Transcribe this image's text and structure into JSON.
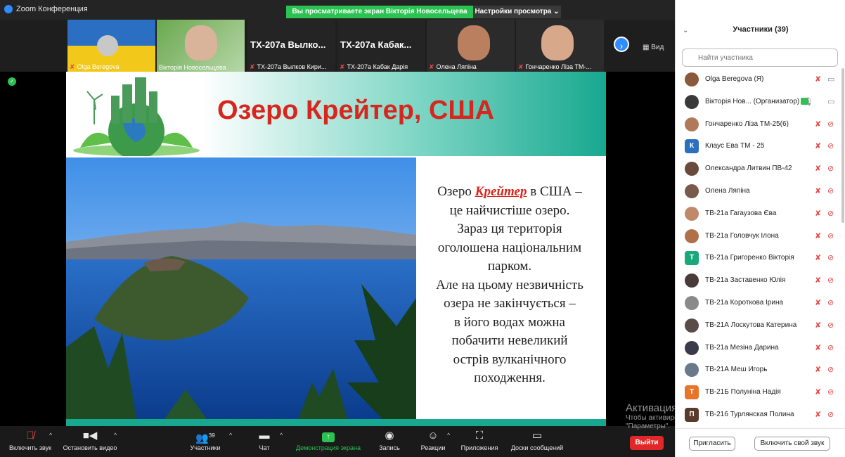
{
  "window": {
    "title": "Zoom Конференция"
  },
  "banner": {
    "viewing_text": "Вы просматриваете экран Вікторія Новосельцева",
    "view_settings": "Настройки просмотра ⌄"
  },
  "window_controls": {
    "minimize": "–",
    "maximize": "◻",
    "close": "✕"
  },
  "thumbnails": [
    {
      "name": "Olga Beregova",
      "muted": true,
      "type": "flag"
    },
    {
      "name": "Вікторія Новосельцева",
      "muted": false,
      "type": "video"
    },
    {
      "name": "ТХ-207а Вылков Кири...",
      "big_label": "ТХ-207а Вылко...",
      "muted": true,
      "type": "text"
    },
    {
      "name": "ТХ-207а Кабак Дарія",
      "big_label": "ТХ-207а Кабак...",
      "muted": true,
      "type": "text"
    },
    {
      "name": "Олена Ляпіна",
      "muted": true,
      "type": "video"
    },
    {
      "name": "Гончаренко Ліза ТМ-...",
      "muted": true,
      "type": "video"
    }
  ],
  "view_button": "Вид",
  "slide": {
    "title": "Озеро Крейтер, США",
    "text_before_link": "Озеро ",
    "link_word": "Крейтер",
    "text_after_link": " в США –",
    "body_lines": [
      "це найчистіше озеро.",
      "Зараз ця територія",
      "оголошена національним",
      "парком.",
      "Але на цьому незвичність",
      "озера не закінчується –",
      "в його водах можна",
      "побачити невеликий",
      "острів вулканічного",
      "походження."
    ]
  },
  "toolbar": {
    "unmute": "Включить звук",
    "stop_video": "Остановить видео",
    "participants": "Участники",
    "participants_count": "39",
    "chat": "Чат",
    "share_screen": "Демонстрация экрана",
    "record": "Запись",
    "reactions": "Реакции",
    "apps": "Приложения",
    "whiteboards": "Доски сообщений",
    "leave": "Выйти"
  },
  "watermark": {
    "line1": "Активация Windows",
    "line2": "Чтобы активировать Windows, перейдите в раздел",
    "line3": "\"Параметры\"."
  },
  "panel": {
    "title": "Участники (39)",
    "search_placeholder": "Найти участника",
    "invite_button": "Пригласить",
    "unmute_me_button": "Включить свой звук",
    "participants": [
      {
        "name": "Olga Beregova (Я)",
        "avatar": "photo",
        "color": "#8a5a3a"
      },
      {
        "name": "Вікторія Нов... (Организатор)",
        "avatar": "photo",
        "color": "#3a3a3a",
        "host": true
      },
      {
        "name": "Гончаренко Ліза ТМ-25(6)",
        "avatar": "photo",
        "color": "#b07a5a"
      },
      {
        "name": "Клаус Ева ТМ - 25",
        "avatar": "К",
        "color": "#2d6fbf"
      },
      {
        "name": "Олександра Литвин ПВ-42",
        "avatar": "photo",
        "color": "#6a4a3a"
      },
      {
        "name": "Олена Ляпіна",
        "avatar": "photo",
        "color": "#7a5a4a"
      },
      {
        "name": "ТВ-21а Гагаузова Єва",
        "avatar": "photo",
        "color": "#c08a6a"
      },
      {
        "name": "ТВ-21а Головчук Ілона",
        "avatar": "photo",
        "color": "#b0704a"
      },
      {
        "name": "ТВ-21а Григоренко Вікторія",
        "avatar": "Т",
        "color": "#1aa87a"
      },
      {
        "name": "ТВ-21а Заставенко Юлія",
        "avatar": "photo",
        "color": "#4a3a3a"
      },
      {
        "name": "ТВ-21а Короткова Ірина",
        "avatar": "photo",
        "color": "#8a8a8a"
      },
      {
        "name": "ТВ-21А Лоскутова Катерина",
        "avatar": "photo",
        "color": "#5a4a4a"
      },
      {
        "name": "ТВ-21а Мезіна Дарина",
        "avatar": "photo",
        "color": "#3a3a4a"
      },
      {
        "name": "ТВ-21А Меш Игорь",
        "avatar": "photo",
        "color": "#6a7a8a"
      },
      {
        "name": "ТВ-21Б Полуніна Надія",
        "avatar": "Т",
        "color": "#e8742a"
      },
      {
        "name": "ТВ-21б Турлянская Полина",
        "avatar": "П",
        "color": "#5a3a2a"
      }
    ]
  }
}
